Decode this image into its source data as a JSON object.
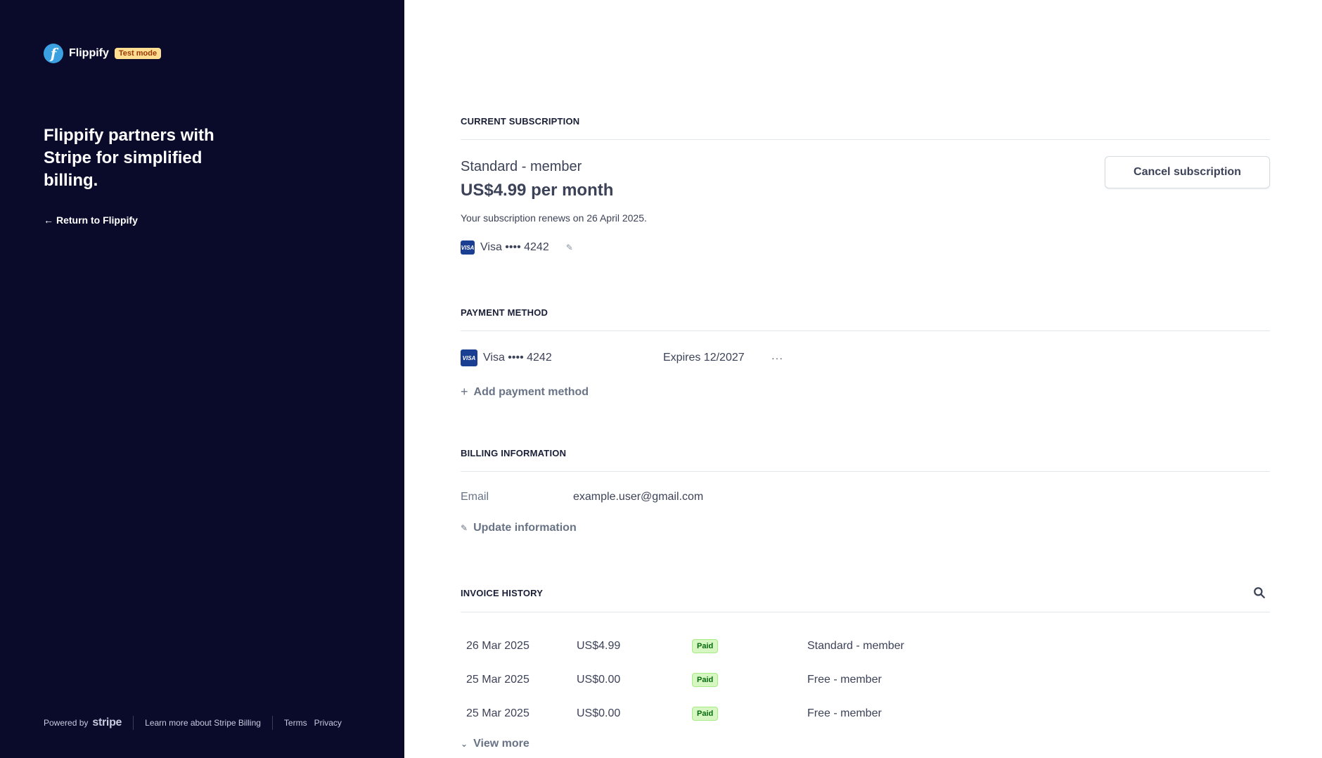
{
  "brand": {
    "name": "Flippify",
    "logo_letter": "f",
    "test_badge": "Test mode"
  },
  "sidebar": {
    "tagline": "Flippify partners with Stripe for simplified billing.",
    "return_link": "Return to Flippify",
    "footer": {
      "powered_by": "Powered by",
      "stripe_word": "stripe",
      "learn_more": "Learn more about Stripe Billing",
      "terms": "Terms",
      "privacy": "Privacy"
    }
  },
  "subscription": {
    "section_title": "CURRENT SUBSCRIPTION",
    "plan_name": "Standard - member",
    "price": "US$4.99 per month",
    "renew_text": "Your subscription renews on 26 April 2025.",
    "card_label": "Visa •••• 4242",
    "cancel_button": "Cancel subscription"
  },
  "payment_method": {
    "section_title": "PAYMENT METHOD",
    "card_label": "Visa •••• 4242",
    "expires": "Expires 12/2027",
    "more": "···",
    "add_label": "Add payment method"
  },
  "billing": {
    "section_title": "BILLING INFORMATION",
    "email_label": "Email",
    "email_value": "example.user@gmail.com",
    "update_label": "Update information"
  },
  "invoices": {
    "section_title": "INVOICE HISTORY",
    "rows": [
      {
        "date": "26 Mar 2025",
        "amount": "US$4.99",
        "status": "Paid",
        "plan": "Standard - member"
      },
      {
        "date": "25 Mar 2025",
        "amount": "US$0.00",
        "status": "Paid",
        "plan": "Free - member"
      },
      {
        "date": "25 Mar 2025",
        "amount": "US$0.00",
        "status": "Paid",
        "plan": "Free - member"
      }
    ],
    "view_more": "View more"
  },
  "icons": {
    "visa_text": "VISA",
    "arrow": "arrow-left-icon",
    "edit": "edit-icon",
    "search": "search-icon",
    "plus": "plus-icon",
    "chevron": "chevron-down-icon"
  },
  "colors": {
    "sidebar_bg": "#0a0b2a",
    "test_badge_bg": "#ffde92",
    "paid_badge_bg": "#d7f7c2",
    "visa_blue": "#1a3e91"
  }
}
